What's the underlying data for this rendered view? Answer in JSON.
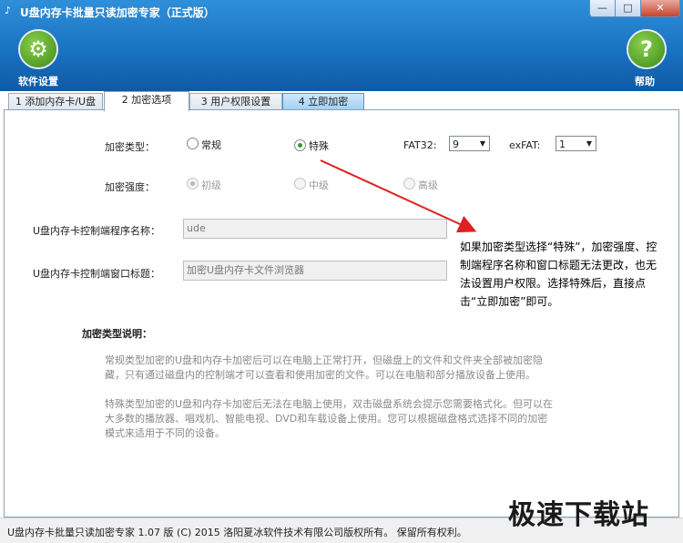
{
  "window": {
    "title": "U盘内存卡批量只读加密专家（正式版）",
    "minimize_glyph": "—",
    "maximize_glyph": "□",
    "close_glyph": "✕"
  },
  "header": {
    "settings_label": "软件设置",
    "help_label": "帮助",
    "help_glyph": "?"
  },
  "tabs": [
    {
      "label": "1 添加内存卡/U盘"
    },
    {
      "label": "2 加密选项"
    },
    {
      "label": "3 用户权限设置"
    },
    {
      "label": "4 立即加密"
    }
  ],
  "encryption_type": {
    "label": "加密类型：",
    "options": [
      "常规",
      "特殊"
    ],
    "selected": "特殊"
  },
  "fat32": {
    "label": "FAT32:",
    "value": "9"
  },
  "exfat": {
    "label": "exFAT:",
    "value": "1"
  },
  "encryption_strength": {
    "label": "加密强度：",
    "options": [
      "初级",
      "中级",
      "高级"
    ],
    "selected": "初级"
  },
  "program_name": {
    "label": "U盘内存卡控制端程序名称：",
    "value": "ude"
  },
  "window_title_field": {
    "label": "U盘内存卡控制端窗口标题：",
    "value": "加密U盘内存卡文件浏览器"
  },
  "description": {
    "heading": "加密类型说明：",
    "normal_text": "常规类型加密的U盘和内存卡加密后可以在电脑上正常打开，但磁盘上的文件和文件夹全部被加密隐藏，只有通过磁盘内的控制端才可以查看和使用加密的文件。可以在电脑和部分播放设备上使用。",
    "special_text": "特殊类型加密的U盘和内存卡加密后无法在电脑上使用，双击磁盘系统会提示您需要格式化。但可以在大多数的播放器、唱戏机、智能电视、DVD和车载设备上使用。您可以根据磁盘格式选择不同的加密模式来适用于不同的设备。"
  },
  "annotation": "如果加密类型选择“特殊”，加密强度、控制端程序名称和窗口标题无法更改，也无法设置用户权限。选择特殊后，直接点击“立即加密”即可。",
  "status": "U盘内存卡批量只读加密专家 1.07 版  (C)  2015 洛阳夏冰软件技术有限公司版权所有。 保留所有权利。",
  "watermark": "极速下载站",
  "colors": {
    "header_blue": "#1a73c2",
    "annotation_arrow": "#e02020",
    "selected_radio": "#3a9a2a"
  }
}
